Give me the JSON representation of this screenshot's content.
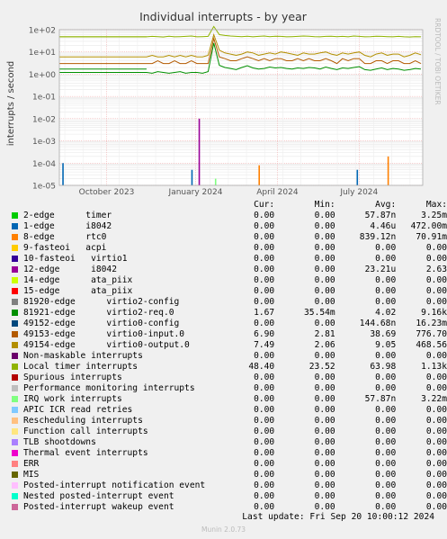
{
  "chart_data": {
    "type": "line",
    "title": "Individual interrupts - by year",
    "ylabel": "interrupts / second",
    "yscale": "log",
    "ylim": [
      "1e-05",
      "1e+02"
    ],
    "y_ticks": [
      "1e+02",
      "1e+01",
      "1e+00",
      "1e-01",
      "1e-02",
      "1e-03",
      "1e-04",
      "1e-05"
    ],
    "x_ticks": [
      "October 2023",
      "January 2024",
      "April 2024",
      "July 2024"
    ],
    "watermark": "RRDTOOL / TOBI OETIKER",
    "grid": true,
    "series_samples": {
      "local_timer": [
        48,
        50,
        49,
        47,
        51,
        48,
        49,
        50,
        52,
        48,
        49,
        50,
        140,
        60,
        55,
        52,
        50,
        49,
        51,
        48,
        50,
        52,
        49,
        51,
        50,
        48,
        49,
        50,
        52,
        51,
        49,
        48,
        50,
        51,
        49,
        50,
        48,
        52,
        50,
        48,
        49,
        51,
        50,
        49,
        48,
        50,
        48,
        47,
        49,
        48
      ],
      "virtio0_output": [
        6,
        7,
        6,
        6,
        7,
        6,
        7,
        6,
        7,
        6,
        6,
        7,
        60,
        12,
        9,
        8,
        7,
        8,
        10,
        9,
        7,
        8,
        9,
        8,
        10,
        9,
        8,
        7,
        9,
        8,
        8,
        9,
        10,
        8,
        7,
        9,
        8,
        9,
        10,
        7,
        6,
        8,
        9,
        7,
        8,
        8,
        6,
        7,
        9,
        7.5
      ],
      "virtio0_input": [
        3,
        3,
        4,
        3,
        3,
        4,
        3,
        3,
        4,
        3,
        3,
        3,
        40,
        6,
        5,
        4,
        4,
        5,
        6,
        5,
        4,
        5,
        4,
        5,
        5,
        4,
        4,
        5,
        4,
        5,
        4,
        4,
        5,
        4,
        3,
        5,
        4,
        5,
        5,
        3,
        3,
        4,
        4,
        3,
        4,
        4,
        3,
        3,
        4,
        3
      ],
      "virtio2_req": [
        1.2,
        1.1,
        1.3,
        1.2,
        1.1,
        1.2,
        1.3,
        1.1,
        1.2,
        1.2,
        1.1,
        1.3,
        25,
        2.5,
        2.0,
        1.8,
        1.6,
        2.0,
        2.4,
        1.9,
        1.7,
        1.8,
        2.1,
        1.9,
        2.0,
        1.8,
        1.7,
        1.9,
        1.8,
        2.0,
        1.9,
        1.7,
        2.1,
        1.8,
        1.6,
        1.9,
        1.8,
        2.0,
        2.2,
        1.6,
        1.5,
        1.7,
        1.9,
        1.6,
        1.8,
        1.7,
        1.5,
        1.6,
        1.8,
        1.7
      ],
      "spikes": [
        {
          "name": "1-edge",
          "x": 0.01,
          "value": 0.0001
        },
        {
          "name": "1-edge",
          "x": 0.365,
          "value": 5e-05
        },
        {
          "name": "12-edge",
          "x": 0.385,
          "value": 0.01
        },
        {
          "name": "8-edge",
          "x": 0.55,
          "value": 8e-05
        },
        {
          "name": "1-edge",
          "x": 0.82,
          "value": 5e-05
        },
        {
          "name": "8-edge",
          "x": 0.905,
          "value": 0.0002
        },
        {
          "name": "IRQ work interrupts",
          "x": 0.43,
          "value": 2e-05
        }
      ]
    }
  },
  "legend": {
    "headers": [
      "Cur:",
      "Min:",
      "Avg:",
      "Max:"
    ],
    "rows": [
      {
        "color": "#00cc00",
        "label": "2-edge      timer",
        "cur": "0.00",
        "min": "0.00",
        "avg": "57.87n",
        "max": "3.25m"
      },
      {
        "color": "#0066b3",
        "label": "1-edge      i8042",
        "cur": "0.00",
        "min": "0.00",
        "avg": "4.46u",
        "max": "472.00m"
      },
      {
        "color": "#ff8000",
        "label": "8-edge      rtc0",
        "cur": "0.00",
        "min": "0.00",
        "avg": "839.12n",
        "max": "70.91m"
      },
      {
        "color": "#ffcc00",
        "label": "9-fasteoi   acpi",
        "cur": "0.00",
        "min": "0.00",
        "avg": "0.00",
        "max": "0.00"
      },
      {
        "color": "#330099",
        "label": "10-fasteoi   virtio1",
        "cur": "0.00",
        "min": "0.00",
        "avg": "0.00",
        "max": "0.00"
      },
      {
        "color": "#990099",
        "label": "12-edge      i8042",
        "cur": "0.00",
        "min": "0.00",
        "avg": "23.21u",
        "max": "2.63"
      },
      {
        "color": "#ccff00",
        "label": "14-edge      ata_piix",
        "cur": "0.00",
        "min": "0.00",
        "avg": "0.00",
        "max": "0.00"
      },
      {
        "color": "#ff0000",
        "label": "15-edge      ata_piix",
        "cur": "0.00",
        "min": "0.00",
        "avg": "0.00",
        "max": "0.00"
      },
      {
        "color": "#808080",
        "label": "81920-edge      virtio2-config",
        "cur": "0.00",
        "min": "0.00",
        "avg": "0.00",
        "max": "0.00"
      },
      {
        "color": "#008f00",
        "label": "81921-edge      virtio2-req.0",
        "cur": "1.67",
        "min": "35.54m",
        "avg": "4.02",
        "max": "9.16k"
      },
      {
        "color": "#00487d",
        "label": "49152-edge      virtio0-config",
        "cur": "0.00",
        "min": "0.00",
        "avg": "144.68n",
        "max": "16.23m"
      },
      {
        "color": "#b35a00",
        "label": "49153-edge      virtio0-input.0",
        "cur": "6.90",
        "min": "2.81",
        "avg": "38.69",
        "max": "776.70"
      },
      {
        "color": "#b38f00",
        "label": "49154-edge      virtio0-output.0",
        "cur": "7.49",
        "min": "2.06",
        "avg": "9.05",
        "max": "468.56"
      },
      {
        "color": "#6b006b",
        "label": "Non-maskable interrupts",
        "cur": "0.00",
        "min": "0.00",
        "avg": "0.00",
        "max": "0.00"
      },
      {
        "color": "#8fb300",
        "label": "Local timer interrupts",
        "cur": "48.40",
        "min": "23.52",
        "avg": "63.98",
        "max": "1.13k"
      },
      {
        "color": "#b30000",
        "label": "Spurious interrupts",
        "cur": "0.00",
        "min": "0.00",
        "avg": "0.00",
        "max": "0.00"
      },
      {
        "color": "#bebebe",
        "label": "Performance monitoring interrupts",
        "cur": "0.00",
        "min": "0.00",
        "avg": "0.00",
        "max": "0.00"
      },
      {
        "color": "#80ff80",
        "label": "IRQ work interrupts",
        "cur": "0.00",
        "min": "0.00",
        "avg": "57.87n",
        "max": "3.22m"
      },
      {
        "color": "#80c9ff",
        "label": "APIC ICR read retries",
        "cur": "0.00",
        "min": "0.00",
        "avg": "0.00",
        "max": "0.00"
      },
      {
        "color": "#ffc080",
        "label": "Rescheduling interrupts",
        "cur": "0.00",
        "min": "0.00",
        "avg": "0.00",
        "max": "0.00"
      },
      {
        "color": "#ffe680",
        "label": "Function call interrupts",
        "cur": "0.00",
        "min": "0.00",
        "avg": "0.00",
        "max": "0.00"
      },
      {
        "color": "#aa80ff",
        "label": "TLB shootdowns",
        "cur": "0.00",
        "min": "0.00",
        "avg": "0.00",
        "max": "0.00"
      },
      {
        "color": "#ee00cc",
        "label": "Thermal event interrupts",
        "cur": "0.00",
        "min": "0.00",
        "avg": "0.00",
        "max": "0.00"
      },
      {
        "color": "#ff8080",
        "label": "ERR",
        "cur": "0.00",
        "min": "0.00",
        "avg": "0.00",
        "max": "0.00"
      },
      {
        "color": "#666600",
        "label": "MIS",
        "cur": "0.00",
        "min": "0.00",
        "avg": "0.00",
        "max": "0.00"
      },
      {
        "color": "#ffbfff",
        "label": "Posted-interrupt notification event",
        "cur": "0.00",
        "min": "0.00",
        "avg": "0.00",
        "max": "0.00"
      },
      {
        "color": "#00ffcc",
        "label": "Nested posted-interrupt event",
        "cur": "0.00",
        "min": "0.00",
        "avg": "0.00",
        "max": "0.00"
      },
      {
        "color": "#cc6699",
        "label": "Posted-interrupt wakeup event",
        "cur": "0.00",
        "min": "0.00",
        "avg": "0.00",
        "max": "0.00"
      }
    ]
  },
  "footer": {
    "last_update": "Last update: Fri Sep 20 10:00:12 2024",
    "generator": "Munin 2.0.73"
  }
}
